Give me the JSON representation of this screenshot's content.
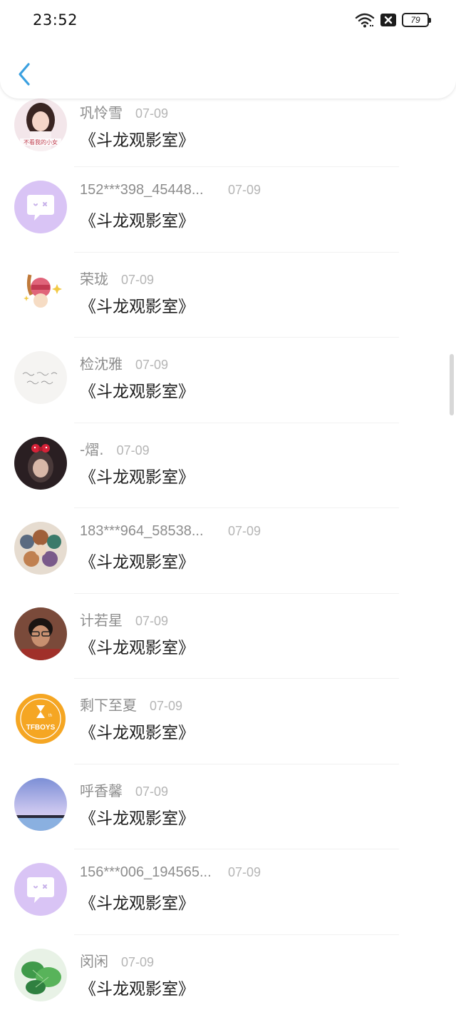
{
  "status_bar": {
    "time": "23:52",
    "battery": "79"
  },
  "items": [
    {
      "name": "巩怜雪",
      "date": "07-09",
      "title": "《斗龙观影室》",
      "avatar": "photo-girl"
    },
    {
      "name": "152***398_45448...",
      "date": "07-09",
      "title": "《斗龙观影室》",
      "avatar": "default-chat"
    },
    {
      "name": "荣珑",
      "date": "07-09",
      "title": "《斗龙观影室》",
      "avatar": "cartoon"
    },
    {
      "name": "检沈雅",
      "date": "07-09",
      "title": "《斗龙观影室》",
      "avatar": "handwriting"
    },
    {
      "name": "-熠.",
      "date": "07-09",
      "title": "《斗龙观影室》",
      "avatar": "photo-bow"
    },
    {
      "name": "183***964_58538...",
      "date": "07-09",
      "title": "《斗龙观影室》",
      "avatar": "anime-group"
    },
    {
      "name": "计若星",
      "date": "07-09",
      "title": "《斗龙观影室》",
      "avatar": "photo-boy"
    },
    {
      "name": "剩下至夏",
      "date": "07-09",
      "title": "《斗龙观影室》",
      "avatar": "tfboys-logo"
    },
    {
      "name": "呼香馨",
      "date": "07-09",
      "title": "《斗龙观影室》",
      "avatar": "sky"
    },
    {
      "name": "156***006_194565...",
      "date": "07-09",
      "title": "《斗龙观影室》",
      "avatar": "default-chat"
    },
    {
      "name": "闵闲",
      "date": "07-09",
      "title": "《斗龙观影室》",
      "avatar": "leaves"
    }
  ],
  "colors": {
    "accent": "#3aa0e0",
    "default_avatar": "#d9c4f5",
    "name_text": "#8d8d8d",
    "title_text": "#1e1e1e"
  }
}
